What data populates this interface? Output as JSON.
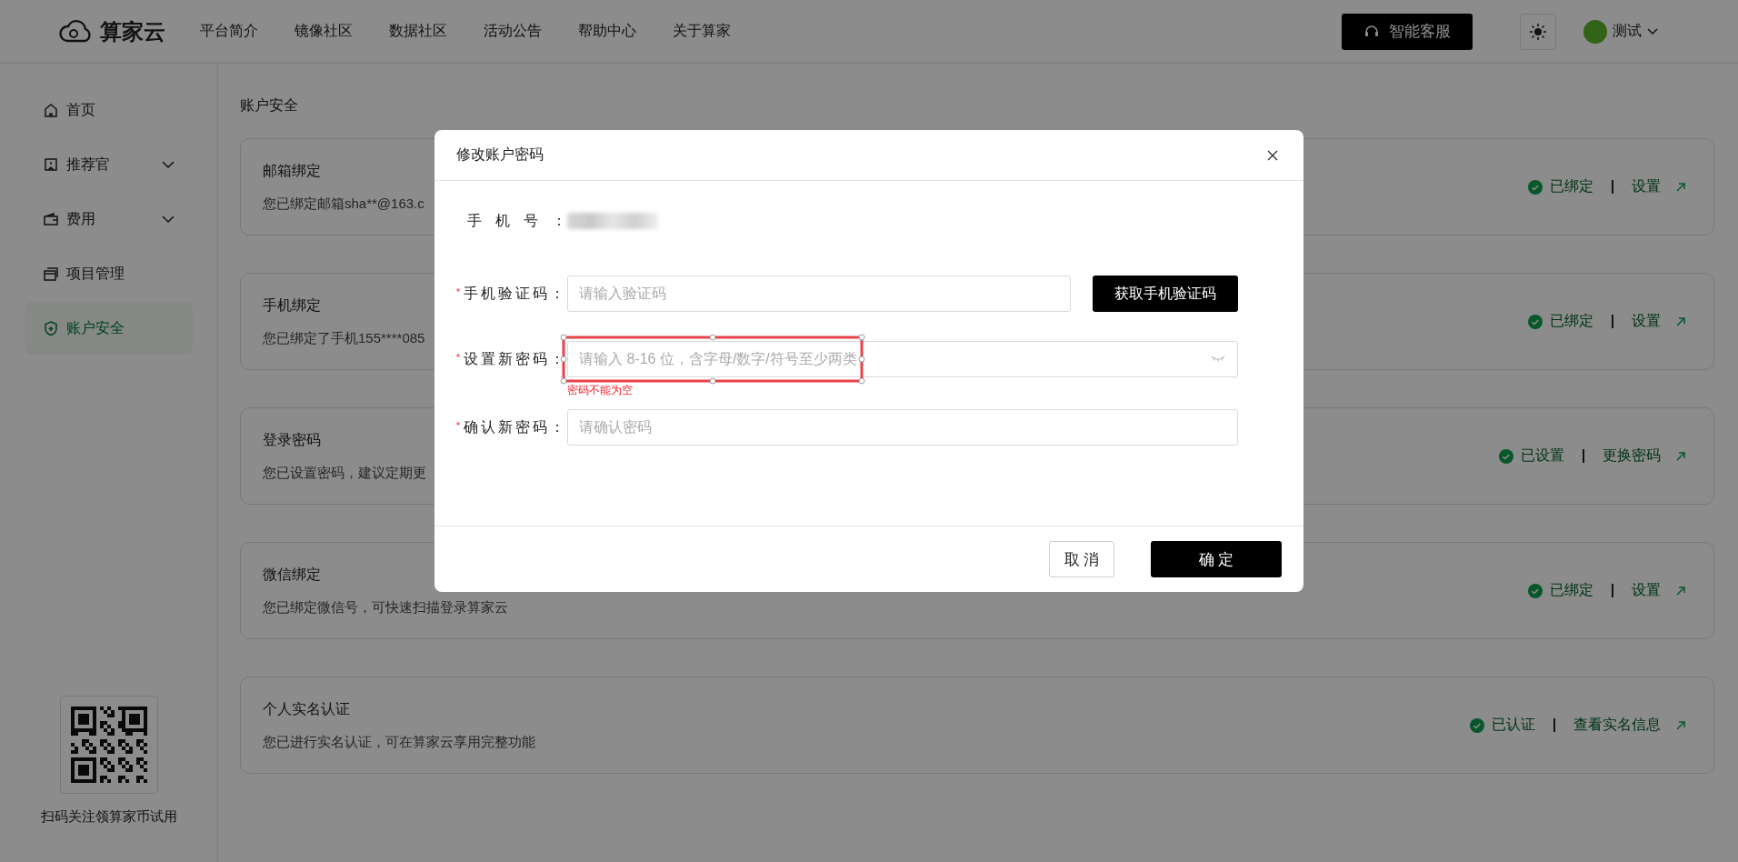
{
  "header": {
    "logo": "算家云",
    "nav": [
      "平台简介",
      "镜像社区",
      "数据社区",
      "活动公告",
      "帮助中心",
      "关于算家"
    ],
    "service_button": "智能客服",
    "user": {
      "name": "测试"
    }
  },
  "sidebar": {
    "items": [
      {
        "label": "首页",
        "expandable": false,
        "selected": false
      },
      {
        "label": "推荐官",
        "expandable": true,
        "selected": false
      },
      {
        "label": "费用",
        "expandable": true,
        "selected": false
      },
      {
        "label": "项目管理",
        "expandable": false,
        "selected": false
      },
      {
        "label": "账户安全",
        "expandable": false,
        "selected": true
      }
    ],
    "qr_caption": "扫码关注领算家币试用"
  },
  "page_title": "账户安全",
  "cards": [
    {
      "title": "邮箱绑定",
      "description": "您已绑定邮箱sha**@163.c",
      "status": "已绑定",
      "action": "设置"
    },
    {
      "title": "手机绑定",
      "description": "您已绑定了手机155****085",
      "status": "已绑定",
      "action": "设置"
    },
    {
      "title": "登录密码",
      "description": "您已设置密码，建议定期更",
      "status": "已设置",
      "action": "更换密码"
    },
    {
      "title": "微信绑定",
      "description": "您已绑定微信号，可快速扫描登录算家云",
      "status": "已绑定",
      "action": "设置"
    },
    {
      "title": "个人实名认证",
      "description": "您已进行实名认证，可在算家云享用完整功能",
      "status": "已认证",
      "action": "查看实名信息"
    }
  ],
  "dialog": {
    "title": "修改账户密码",
    "fields": [
      {
        "kind": "static",
        "label": "手机号：",
        "required": false
      },
      {
        "kind": "code",
        "label": "手机验证码：",
        "required": true,
        "placeholder": "请输入验证码",
        "button": "获取手机验证码"
      },
      {
        "kind": "password",
        "label": "设置新密码：",
        "required": true,
        "placeholder": "请输入 8-16 位，含字母/数字/符号至少两类",
        "error": "密码不能为空",
        "highlighted": true
      },
      {
        "kind": "text",
        "label": "确认新密码：",
        "required": true,
        "placeholder": "请确认密码"
      }
    ],
    "buttons": [
      {
        "label": "取 消",
        "primary": false
      },
      {
        "label": "确 定",
        "primary": true
      }
    ]
  }
}
